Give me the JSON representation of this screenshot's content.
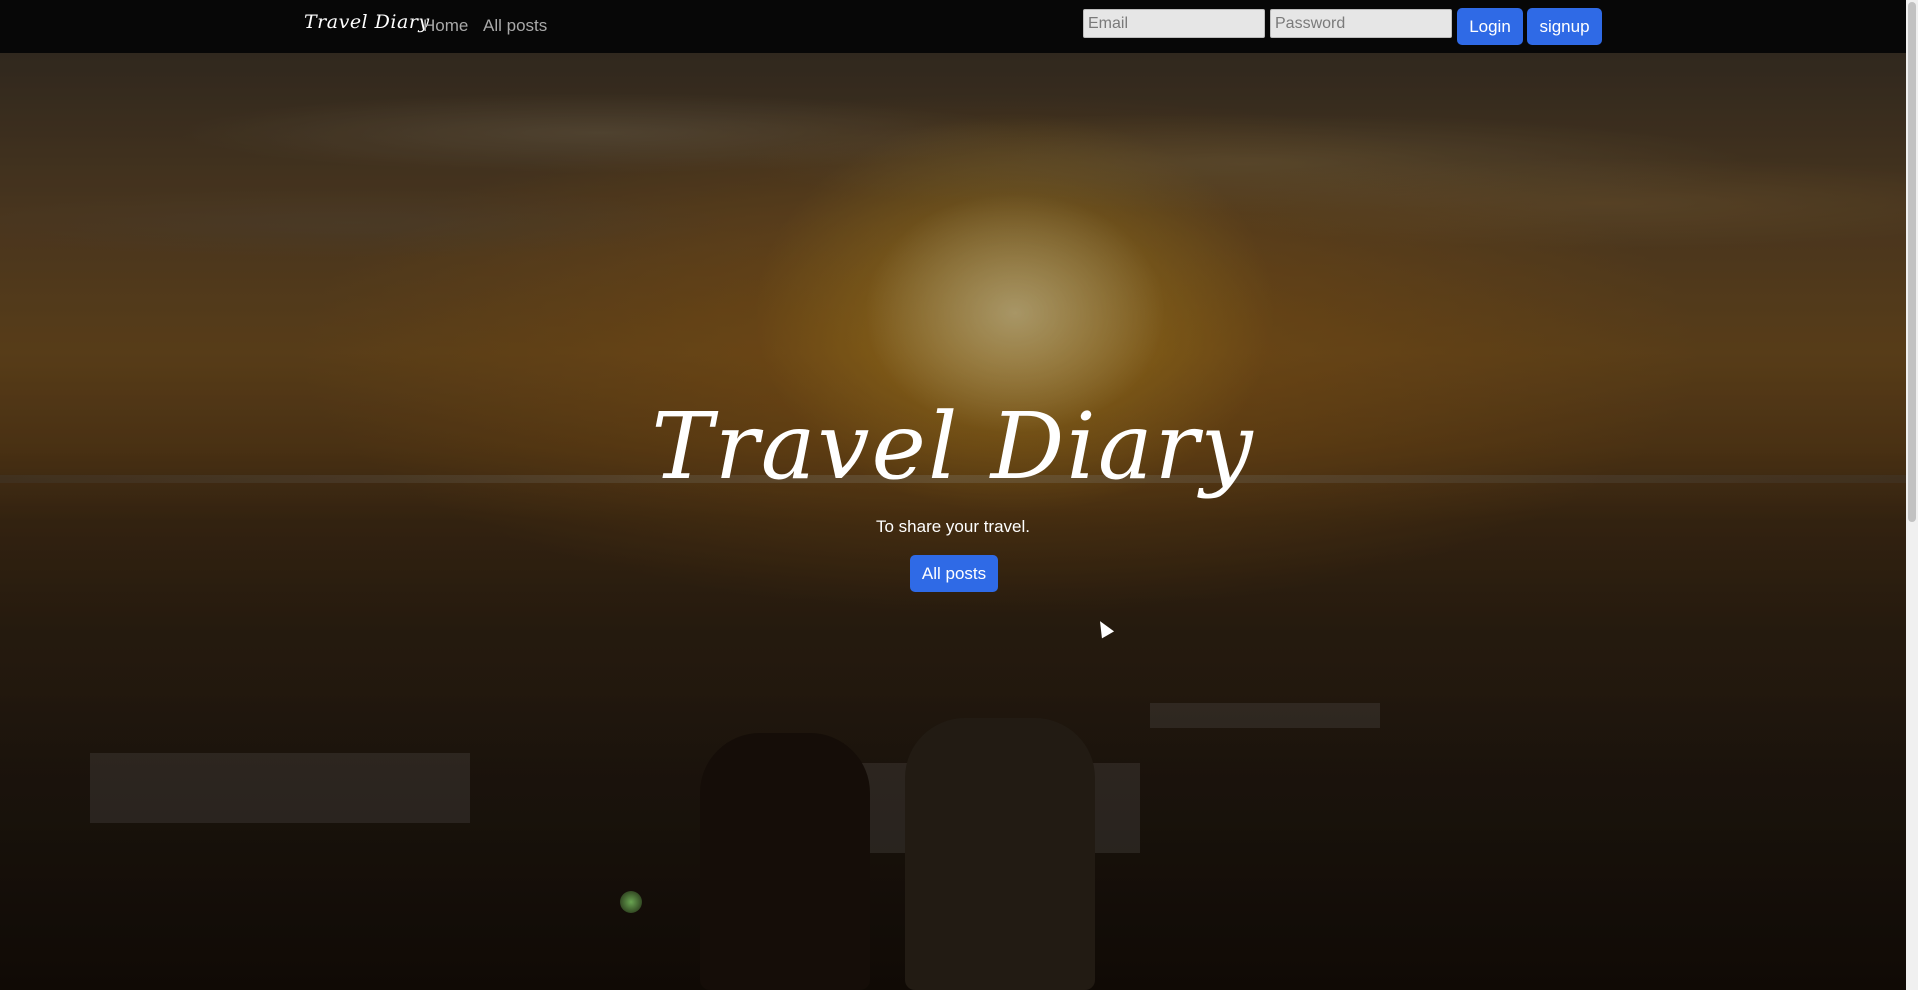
{
  "navbar": {
    "brand": "Travel Diary",
    "links": [
      {
        "label": "Home"
      },
      {
        "label": "All posts"
      }
    ],
    "login_form": {
      "email_placeholder": "Email",
      "password_placeholder": "Password",
      "login_label": "Login",
      "signup_label": "signup"
    }
  },
  "hero": {
    "title": "Travel Diary",
    "subtitle": "To share your travel.",
    "button_label": "All posts"
  },
  "colors": {
    "navbar_bg": "#070707",
    "button_bg": "#2f6ae6"
  }
}
